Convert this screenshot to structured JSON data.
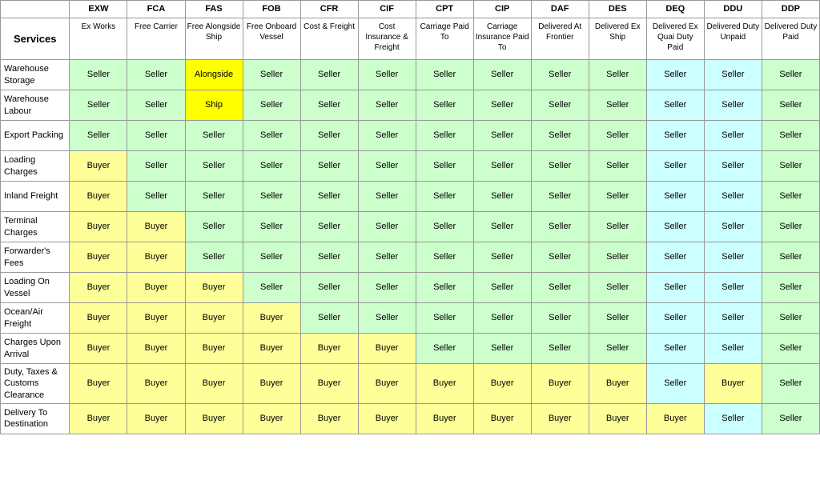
{
  "table": {
    "headers": [
      "EXW",
      "FCA",
      "FAS",
      "FOB",
      "CFR",
      "CIF",
      "CPT",
      "CIP",
      "DAF",
      "DES",
      "DEQ",
      "DDU",
      "DDP"
    ],
    "subheaders": [
      "Ex Works",
      "Free Carrier",
      "Free Alongside Ship",
      "Free Onboard Vessel",
      "Cost & Freight",
      "Cost Insurance & Freight",
      "Carriage Paid To",
      "Carriage Insurance Paid To",
      "Delivered At Frontier",
      "Delivered Ex Ship",
      "Delivered Ex Quai Duty Paid",
      "Delivered Duty Unpaid",
      "Delivered Duty Paid"
    ],
    "services_label": "Services",
    "rows": [
      {
        "name": "Warehouse Storage",
        "cells": [
          "Seller",
          "Seller",
          "Alongside",
          "Seller",
          "Seller",
          "Seller",
          "Seller",
          "Seller",
          "Seller",
          "Seller",
          "Seller",
          "Seller",
          "Seller"
        ]
      },
      {
        "name": "Warehouse Labour",
        "cells": [
          "Seller",
          "Seller",
          "Ship",
          "Seller",
          "Seller",
          "Seller",
          "Seller",
          "Seller",
          "Seller",
          "Seller",
          "Seller",
          "Seller",
          "Seller"
        ]
      },
      {
        "name": "Export Packing",
        "cells": [
          "Seller",
          "Seller",
          "Seller",
          "Seller",
          "Seller",
          "Seller",
          "Seller",
          "Seller",
          "Seller",
          "Seller",
          "Seller",
          "Seller",
          "Seller"
        ]
      },
      {
        "name": "Loading Charges",
        "cells": [
          "Buyer",
          "Seller",
          "Seller",
          "Seller",
          "Seller",
          "Seller",
          "Seller",
          "Seller",
          "Seller",
          "Seller",
          "Seller",
          "Seller",
          "Seller"
        ]
      },
      {
        "name": "Inland Freight",
        "cells": [
          "Buyer",
          "Seller",
          "Seller",
          "Seller",
          "Seller",
          "Seller",
          "Seller",
          "Seller",
          "Seller",
          "Seller",
          "Seller",
          "Seller",
          "Seller"
        ]
      },
      {
        "name": "Terminal Charges",
        "cells": [
          "Buyer",
          "Buyer",
          "Seller",
          "Seller",
          "Seller",
          "Seller",
          "Seller",
          "Seller",
          "Seller",
          "Seller",
          "Seller",
          "Seller",
          "Seller"
        ]
      },
      {
        "name": "Forwarder's Fees",
        "cells": [
          "Buyer",
          "Buyer",
          "Seller",
          "Seller",
          "Seller",
          "Seller",
          "Seller",
          "Seller",
          "Seller",
          "Seller",
          "Seller",
          "Seller",
          "Seller"
        ]
      },
      {
        "name": "Loading On Vessel",
        "cells": [
          "Buyer",
          "Buyer",
          "Buyer",
          "Seller",
          "Seller",
          "Seller",
          "Seller",
          "Seller",
          "Seller",
          "Seller",
          "Seller",
          "Seller",
          "Seller"
        ]
      },
      {
        "name": "Ocean/Air Freight",
        "cells": [
          "Buyer",
          "Buyer",
          "Buyer",
          "Buyer",
          "Seller",
          "Seller",
          "Seller",
          "Seller",
          "Seller",
          "Seller",
          "Seller",
          "Seller",
          "Seller"
        ]
      },
      {
        "name": "Charges Upon Arrival",
        "cells": [
          "Buyer",
          "Buyer",
          "Buyer",
          "Buyer",
          "Buyer",
          "Buyer",
          "Seller",
          "Seller",
          "Seller",
          "Seller",
          "Seller",
          "Seller",
          "Seller"
        ]
      },
      {
        "name": "Duty, Taxes & Customs Clearance",
        "cells": [
          "Buyer",
          "Buyer",
          "Buyer",
          "Buyer",
          "Buyer",
          "Buyer",
          "Buyer",
          "Buyer",
          "Buyer",
          "Buyer",
          "Seller",
          "Buyer",
          "Seller"
        ]
      },
      {
        "name": "Delivery To Destination",
        "cells": [
          "Buyer",
          "Buyer",
          "Buyer",
          "Buyer",
          "Buyer",
          "Buyer",
          "Buyer",
          "Buyer",
          "Buyer",
          "Buyer",
          "Buyer",
          "Seller",
          "Seller"
        ]
      }
    ]
  }
}
